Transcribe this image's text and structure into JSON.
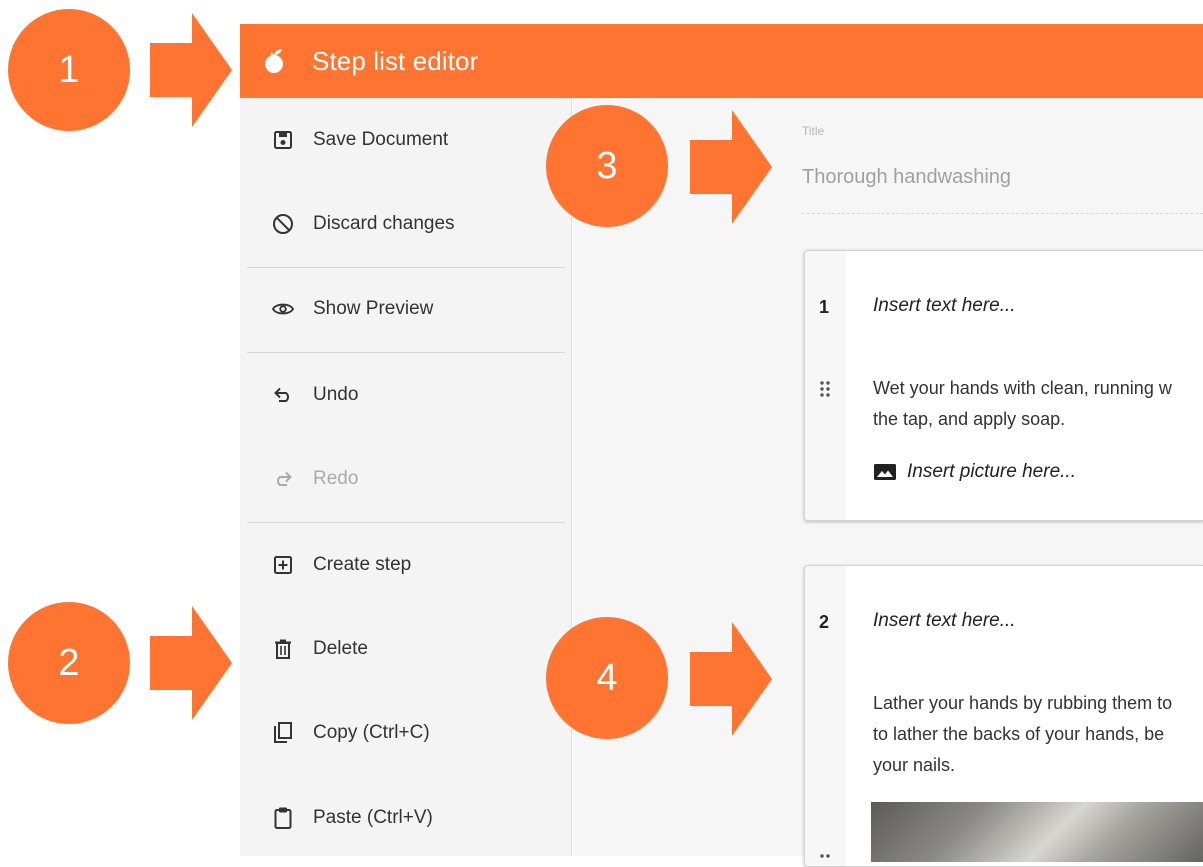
{
  "colors": {
    "accent": "#ff7430",
    "sidebar_bg": "#f4f4f4",
    "main_bg": "#f6f6f6"
  },
  "header": {
    "title": "Step list editor",
    "logo_icon": "peach-icon"
  },
  "sidebar": {
    "items": [
      {
        "label": "Save Document",
        "icon": "save-icon",
        "enabled": true
      },
      {
        "label": "Discard changes",
        "icon": "block-icon",
        "enabled": true
      },
      {
        "label": "Show Preview",
        "icon": "eye-icon",
        "enabled": true
      },
      {
        "label": "Undo",
        "icon": "undo-icon",
        "enabled": true
      },
      {
        "label": "Redo",
        "icon": "redo-icon",
        "enabled": false
      },
      {
        "label": "Create step",
        "icon": "add-box-icon",
        "enabled": true
      },
      {
        "label": "Delete",
        "icon": "trash-icon",
        "enabled": true
      },
      {
        "label": "Copy (Ctrl+C)",
        "icon": "copy-icon",
        "enabled": true
      },
      {
        "label": "Paste (Ctrl+V)",
        "icon": "paste-icon",
        "enabled": true
      }
    ]
  },
  "document": {
    "title_label": "Title",
    "title_value": "Thorough handwashing",
    "steps": [
      {
        "number": "1",
        "heading": "Insert text here...",
        "text_lines": [
          "Wet your hands with clean, running w",
          "the tap, and apply soap."
        ],
        "picture_placeholder": "Insert picture here..."
      },
      {
        "number": "2",
        "heading": "Insert text here...",
        "text_lines": [
          "Lather your hands by rubbing them to",
          "to lather the backs of your hands, be",
          "your nails."
        ]
      }
    ]
  },
  "callouts": [
    "1",
    "2",
    "3",
    "4"
  ]
}
